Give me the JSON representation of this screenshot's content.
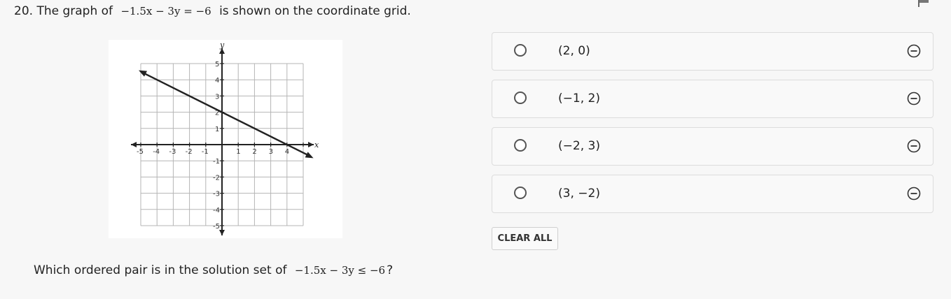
{
  "question": {
    "number": "20.",
    "text_before": "The graph of",
    "equation": "−1.5x − 3y = −6",
    "text_after": "is shown on the coordinate grid."
  },
  "graph": {
    "x_axis_label": "x",
    "y_axis_label": "y",
    "x_ticks": [
      "-5",
      "-4",
      "-3",
      "-2",
      "-1",
      "1",
      "2",
      "3",
      "4"
    ],
    "y_ticks": [
      "5",
      "4",
      "3",
      "2",
      "1",
      "-1",
      "-2",
      "-3",
      "-4",
      "-5"
    ],
    "line_points": [
      [
        -5,
        4.5
      ],
      [
        5.5,
        -0.75
      ]
    ]
  },
  "prompt": {
    "text_before": "Which ordered pair is in the solution set of",
    "inequality": "−1.5x − 3y ≤ −6",
    "text_after": "?"
  },
  "options": [
    {
      "label": "(2, 0)"
    },
    {
      "label": "(−1, 2)"
    },
    {
      "label": "(−2, 3)"
    },
    {
      "label": "(3, −2)"
    }
  ],
  "clear_all_label": "CLEAR ALL",
  "icons": {
    "flag": "flag-icon",
    "radio": "radio-button",
    "eliminate": "minus-circle-icon"
  }
}
